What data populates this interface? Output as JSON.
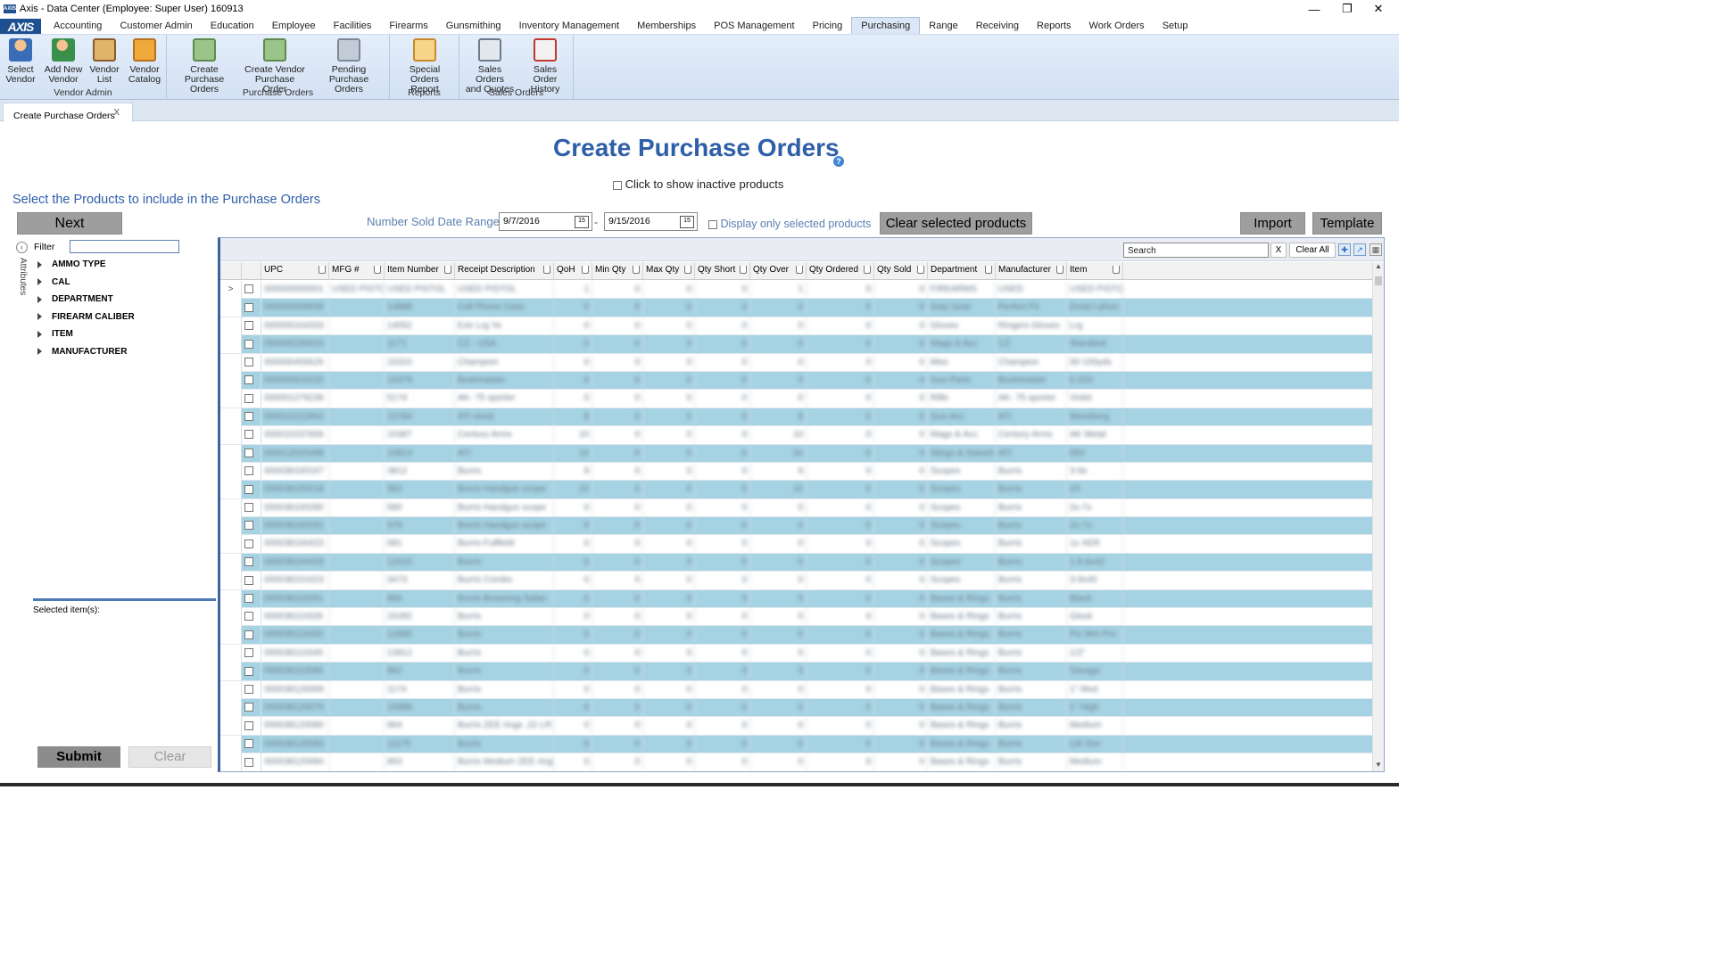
{
  "window": {
    "title": "Axis - Data Center  (Employee: Super User) 160913",
    "logo": "AXIS",
    "minimize_icon": "minimize-icon",
    "restore_icon": "restore-icon",
    "close_icon": "close-icon"
  },
  "menu": {
    "brand": "AXIS",
    "tabs": [
      "Accounting",
      "Customer Admin",
      "Education",
      "Employee",
      "Facilities",
      "Firearms",
      "Gunsmithing",
      "Inventory Management",
      "Memberships",
      "POS Management",
      "Pricing",
      "Purchasing",
      "Range",
      "Receiving",
      "Reports",
      "Work Orders",
      "Setup"
    ],
    "active_tab": "Purchasing"
  },
  "ribbon": {
    "groups": [
      {
        "label": "Vendor Admin",
        "buttons": [
          [
            "Select",
            "Vendor"
          ],
          [
            "Add New",
            "Vendor"
          ],
          [
            "Vendor",
            "List"
          ],
          [
            "Vendor",
            "Catalog"
          ]
        ]
      },
      {
        "label": "Purchase Orders",
        "buttons": [
          [
            "Create Purchase",
            "Orders"
          ],
          [
            "Create Vendor",
            "Purchase Order"
          ],
          [
            "Pending Purchase",
            "Orders"
          ]
        ]
      },
      {
        "label": "Reports",
        "buttons": [
          [
            "Special Orders",
            "Report"
          ]
        ]
      },
      {
        "label": "Sales Orders",
        "buttons": [
          [
            "Sales Orders",
            "and Quotes"
          ],
          [
            "Sales Order",
            "History"
          ]
        ]
      }
    ]
  },
  "doc_tab": {
    "label": "Create Purchase Orders",
    "close": "X"
  },
  "page": {
    "title": "Create Purchase Orders",
    "help": "?",
    "inactive_label": "Click to show inactive products",
    "subtitle": "Select the Products to include in the Purchase Orders",
    "next_button": "Next",
    "date_range_label": "Number Sold Date Range:",
    "date_from": "9/7/2016",
    "date_to": "9/15/2016",
    "date_dash": "-",
    "calendar_icon_text": "15",
    "display_only_selected": "Display only selected products",
    "clear_selected_button": "Clear selected products",
    "import_button": "Import",
    "template_button": "Template"
  },
  "attributes": {
    "collapse_icon": "‹",
    "vertical_label": "Attributes",
    "filter_label": "Filter",
    "filter_value": "",
    "items": [
      "AMMO TYPE",
      "CAL",
      "DEPARTMENT",
      "FIREARM CALIBER",
      "ITEM",
      "MANUFACTURER"
    ],
    "selected_label": "Selected item(s):",
    "submit_button": "Submit",
    "clear_button": "Clear"
  },
  "grid": {
    "search_placeholder": "Search",
    "search_clear": "X",
    "clear_all": "Clear All",
    "columns": [
      "UPC",
      "MFG #",
      "Item Number",
      "Receipt Description",
      "QoH",
      "Min Qty",
      "Max Qty",
      "Qty Short",
      "Qty Over",
      "Qty Ordered",
      "Qty Sold",
      "Department",
      "Manufacturer",
      "Item"
    ],
    "current_row_indicator": ">",
    "rows": [
      [
        "000000000001",
        "USED PISTOL",
        "USED PISTOL",
        "USED PISTOL",
        "1",
        "0",
        "0",
        "0",
        "1",
        "0",
        "0",
        "FIREARMS",
        "USED",
        "USED PISTOL"
      ],
      [
        "000000008938",
        "",
        "14888",
        "Cell Phone Case",
        "0",
        "0",
        "0",
        "0",
        "0",
        "0",
        "0",
        "Duty Gear",
        "Perfect Fit",
        "Droid I-phon"
      ],
      [
        "000000104333",
        "",
        "14052",
        "Extr Lrg Ye",
        "0",
        "0",
        "0",
        "0",
        "0",
        "0",
        "0",
        "Gloves",
        "Ringers Gloves",
        "Lrg"
      ],
      [
        "000000190015",
        "",
        "1171",
        "CZ - USA",
        "0",
        "0",
        "0",
        "0",
        "0",
        "0",
        "0",
        "Mags & Acc",
        "CZ",
        "Standard"
      ],
      [
        "000000455626",
        "",
        "16310",
        "Champion",
        "0",
        "0",
        "0",
        "0",
        "0",
        "0",
        "0",
        "Misc",
        "Champion",
        "50-100yds"
      ],
      [
        "000000816220",
        "",
        "15379",
        "Bushmaster",
        "0",
        "0",
        "0",
        "0",
        "0",
        "0",
        "0",
        "Gun Parts",
        "Bushmaster",
        "0.223"
      ],
      [
        "000001279238",
        "",
        "5174",
        "AK- 75 sporter",
        "0",
        "0",
        "0",
        "0",
        "0",
        "0",
        "0",
        "Rifle",
        "AK- 75 sporter",
        "Violet"
      ],
      [
        "000010211864",
        "",
        "12784",
        "ATI stock",
        "8",
        "0",
        "0",
        "0",
        "8",
        "0",
        "0",
        "Gun Acc",
        "ATI",
        "Mossberg"
      ],
      [
        "000010237656",
        "",
        "10387",
        "Century Arms",
        "10",
        "0",
        "0",
        "0",
        "10",
        "0",
        "0",
        "Mags & Acc",
        "Century Arms",
        "AK Metal"
      ],
      [
        "000012025498",
        "",
        "10814",
        "ATI",
        "10",
        "0",
        "0",
        "0",
        "10",
        "0",
        "0",
        "Slings & Swivels",
        "ATI",
        "050"
      ],
      [
        "000038100167",
        "",
        "3812",
        "Burris",
        "9",
        "0",
        "0",
        "0",
        "9",
        "0",
        "0",
        "Scopes",
        "Burris",
        "3-9x"
      ],
      [
        "000038100218",
        "",
        "582",
        "Burris Handgun scope",
        "10",
        "0",
        "0",
        "0",
        "10",
        "0",
        "0",
        "Scopes",
        "Burris",
        "2X"
      ],
      [
        "000038100280",
        "",
        "580",
        "Burris Handgun scope",
        "0",
        "0",
        "0",
        "0",
        "0",
        "0",
        "0",
        "Scopes",
        "Burris",
        "2x-7x"
      ],
      [
        "000038100291",
        "",
        "579",
        "Burris Handgun scope",
        "0",
        "0",
        "0",
        "0",
        "0",
        "0",
        "0",
        "Scopes",
        "Burris",
        "2x-7x"
      ],
      [
        "000038100423",
        "",
        "581",
        "Burris Fullfield",
        "0",
        "0",
        "0",
        "0",
        "0",
        "0",
        "0",
        "Scopes",
        "Burris",
        "1x XER"
      ],
      [
        "000038100429",
        "",
        "12015",
        "Burris",
        "0",
        "0",
        "0",
        "0",
        "0",
        "0",
        "0",
        "Scopes",
        "Burris",
        "1.5-6x42"
      ],
      [
        "000038101623",
        "",
        "3473",
        "Burris Combo",
        "0",
        "0",
        "0",
        "0",
        "0",
        "0",
        "0",
        "Scopes",
        "Burris",
        "3-9x40"
      ],
      [
        "000038110291",
        "",
        "866",
        "Burris Browning Safari",
        "0",
        "0",
        "0",
        "0",
        "0",
        "0",
        "0",
        "Bases & Rings",
        "Burris",
        "Black"
      ],
      [
        "000038110326",
        "",
        "15282",
        "Burris",
        "0",
        "0",
        "0",
        "0",
        "0",
        "0",
        "0",
        "Bases & Rings",
        "Burris",
        "Glock"
      ],
      [
        "000038110330",
        "",
        "12680",
        "Burris",
        "0",
        "0",
        "0",
        "0",
        "0",
        "0",
        "0",
        "Bases & Rings",
        "Burris",
        "Pic Mnt Pro"
      ],
      [
        "000038110340",
        "",
        "13912",
        "Burris",
        "0",
        "0",
        "0",
        "0",
        "0",
        "0",
        "0",
        "Bases & Rings",
        "Burris",
        "1/2\""
      ],
      [
        "000038110586",
        "",
        "862",
        "Burris",
        "0",
        "0",
        "0",
        "0",
        "0",
        "0",
        "0",
        "Bases & Rings",
        "Burris",
        "Savage"
      ],
      [
        "000038120069",
        "",
        "1174",
        "Burris",
        "0",
        "0",
        "0",
        "0",
        "0",
        "0",
        "0",
        "Bases & Rings",
        "Burris",
        "1\" Med"
      ],
      [
        "000038120079",
        "",
        "15989",
        "Burris",
        "0",
        "0",
        "0",
        "0",
        "0",
        "0",
        "0",
        "Bases & Rings",
        "Burris",
        "1\" High"
      ],
      [
        "000038120080",
        "",
        "864",
        "Burris ZEE rings .22 LR",
        "0",
        "0",
        "0",
        "0",
        "0",
        "0",
        "0",
        "Bases & Rings",
        "Burris",
        "Medium"
      ],
      [
        "000038120083",
        "",
        "11175",
        "Burris",
        "0",
        "0",
        "0",
        "0",
        "0",
        "0",
        "0",
        "Bases & Rings",
        "Burris",
        "LW Zee"
      ],
      [
        "000038120084",
        "",
        "863",
        "Burris Medium ZEE rings",
        "0",
        "0",
        "0",
        "0",
        "0",
        "0",
        "0",
        "Bases & Rings",
        "Burris",
        "Medium"
      ]
    ]
  }
}
